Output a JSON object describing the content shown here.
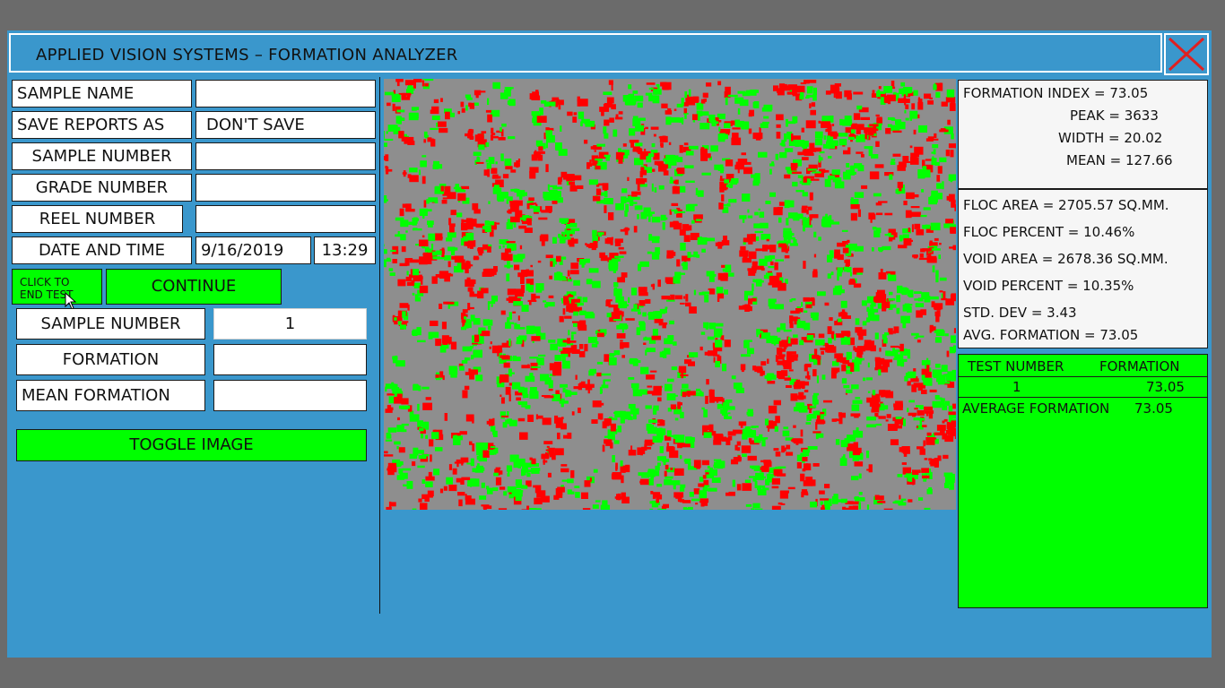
{
  "window": {
    "title": "APPLIED VISION SYSTEMS – FORMATION ANALYZER",
    "close_icon": "close-x-icon",
    "close_color": "#e02020"
  },
  "form": {
    "sample_name_label": "SAMPLE NAME",
    "sample_name_value": "",
    "save_reports_label": "SAVE REPORTS AS",
    "save_reports_value": "DON'T SAVE",
    "sample_number_label": "SAMPLE NUMBER",
    "sample_number_value": "",
    "grade_number_label": "GRADE NUMBER",
    "grade_number_value": "",
    "reel_number_label": "REEL NUMBER",
    "reel_number_value": "",
    "date_time_label": "DATE AND TIME",
    "date_value": "9/16/2019",
    "time_value": "13:29"
  },
  "controls": {
    "end_test_line1": "CLICK TO",
    "end_test_line2": "END  TEST",
    "continue_label": "CONTINUE",
    "toggle_image_label": "TOGGLE IMAGE"
  },
  "current": {
    "sample_number_label": "SAMPLE NUMBER",
    "sample_number_value": "1",
    "formation_label": "FORMATION",
    "formation_value": "",
    "mean_formation_label": "MEAN FORMATION",
    "mean_formation_value": ""
  },
  "stats": {
    "formation_index": "FORMATION INDEX = 73.05",
    "peak": "PEAK = 3633",
    "width": "WIDTH = 20.02",
    "mean": "MEAN = 127.66",
    "floc_area": "FLOC AREA = 2705.57 SQ.MM.",
    "floc_percent": "FLOC PERCENT = 10.46%",
    "void_area": "VOID AREA = 2678.36 SQ.MM.",
    "void_percent": "VOID PERCENT = 10.35%",
    "std_dev": "STD. DEV = 3.43",
    "avg_formation": "AVG. FORMATION = 73.05"
  },
  "results": {
    "col_test_number": "TEST NUMBER",
    "col_formation": "FORMATION",
    "rows": [
      {
        "test_number": "1",
        "formation": "73.05"
      }
    ],
    "average_label": "AVERAGE FORMATION",
    "average_value": "73.05"
  },
  "image": {
    "description_colors": {
      "background": "#8e8e8e",
      "floc": "#ff0000",
      "void": "#00ff00"
    }
  }
}
